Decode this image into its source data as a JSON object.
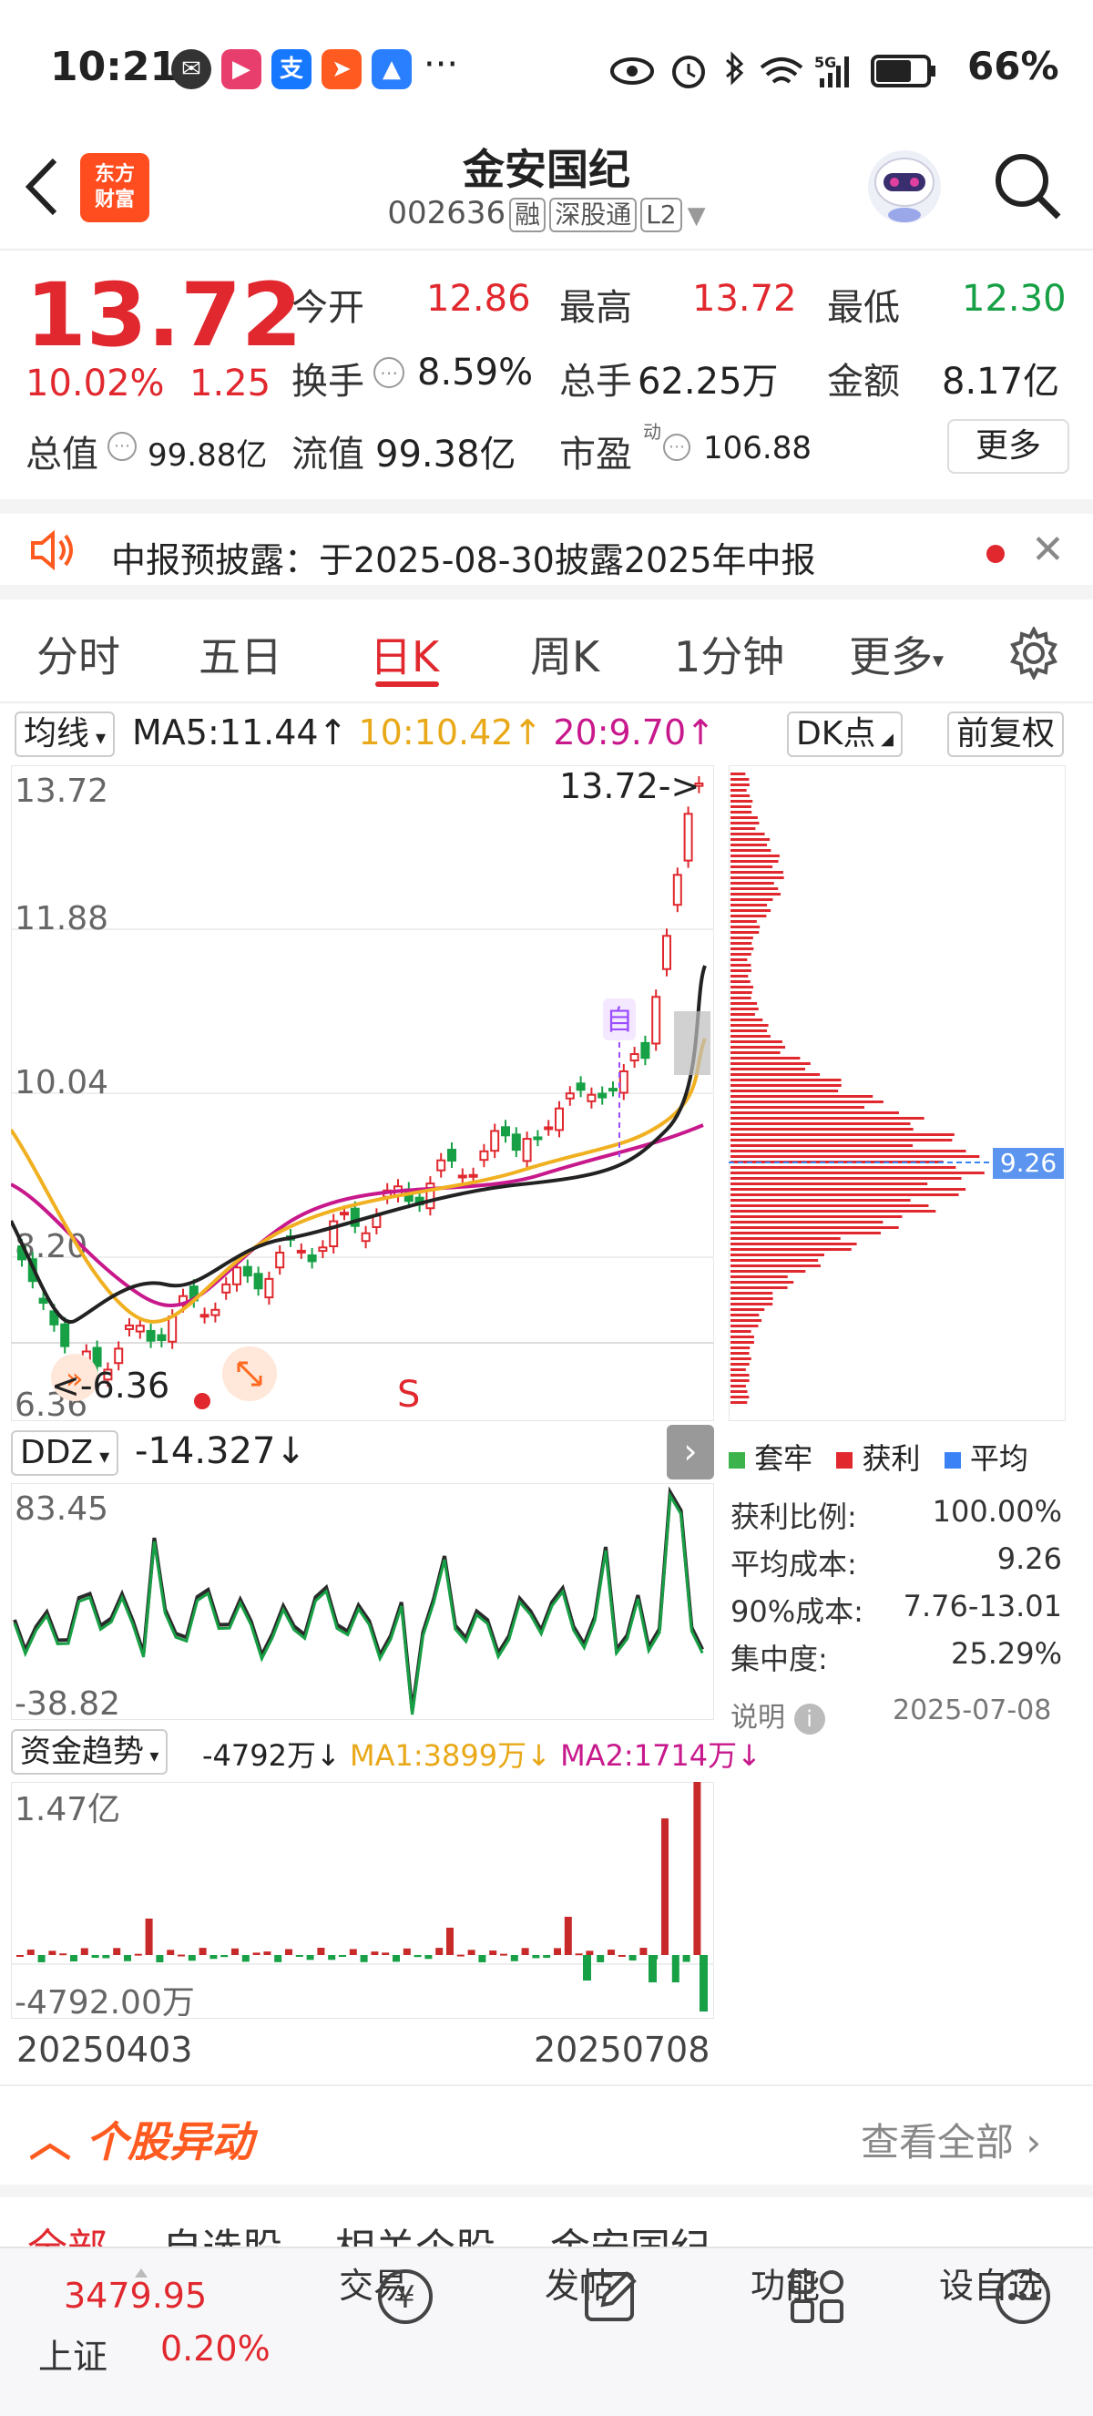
{
  "status_bar": {
    "time": "10:21",
    "battery": "66%",
    "icons": [
      "wechat-icon",
      "video-app-icon",
      "alipay-icon",
      "send-app-icon",
      "nav-app-icon",
      "more-dots",
      "eye-icon",
      "alarm-icon",
      "bluetooth-icon",
      "wifi-icon",
      "5g-signal-icon",
      "battery-icon"
    ]
  },
  "header": {
    "logo_line1": "东方",
    "logo_line2": "财富",
    "stock_name": "金安国纪",
    "stock_code": "002636",
    "tags": [
      "融",
      "深股通",
      "L2"
    ]
  },
  "quote": {
    "price": "13.72",
    "change_pct": "10.02%",
    "change_amt": "1.25",
    "open_label": "今开",
    "open": "12.86",
    "high_label": "最高",
    "high": "13.72",
    "low_label": "最低",
    "low": "12.30",
    "turnover_label": "换手",
    "turnover": "8.59%",
    "volume_label": "总手",
    "volume": "62.25万",
    "amount_label": "金额",
    "amount": "8.17亿",
    "mktcap_label": "总值",
    "mktcap": "99.88亿",
    "float_label": "流值",
    "float_cap": "99.38亿",
    "pe_label": "市盈",
    "pe_sup": "动",
    "pe": "106.88",
    "more_label": "更多"
  },
  "notice": {
    "text": "中报预披露：于2025-08-30披露2025年中报"
  },
  "tabs": [
    "分时",
    "五日",
    "日K",
    "周K",
    "1分钟",
    "更多"
  ],
  "active_tab": "日K",
  "kline_toolbar": {
    "indicator": "均线",
    "ma5": "MA5:11.44↑",
    "ma10": "10:10.42↑",
    "ma20": "20:9.70↑",
    "dk_label": "DK点",
    "adjust_label": "前复权",
    "colors": {
      "ma5": "#222222",
      "ma10": "#f0b020",
      "ma20": "#c8198c"
    }
  },
  "kline": {
    "y_ticks": [
      "13.72",
      "11.88",
      "10.04",
      "8.20",
      "6.36"
    ],
    "high_marker": "13.72->",
    "low_marker": "<-6.36",
    "self_marker": "自",
    "s_marker": "S"
  },
  "chip": {
    "avg_label": "9.26",
    "legend": [
      "套牢",
      "获利",
      "平均"
    ],
    "legend_colors": [
      "#3cb44b",
      "#e0282e",
      "#3b82f6"
    ],
    "stats": [
      {
        "label": "获利比例:",
        "value": "100.00%"
      },
      {
        "label": "平均成本:",
        "value": "9.26"
      },
      {
        "label": "90%成本:",
        "value": "7.76-13.01"
      },
      {
        "label": "集中度:",
        "value": "25.29%"
      }
    ],
    "note_label": "说明",
    "date": "2025-07-08"
  },
  "ddz": {
    "label": "DDZ",
    "value": "-14.327↓",
    "max": "83.45",
    "min": "-38.82"
  },
  "fund": {
    "label": "资金趋势",
    "value": "-4792万↓",
    "ma1": "MA1:3899万↓",
    "ma2": "MA2:1714万↓",
    "max": "1.47亿",
    "min": "-4792.00万",
    "date_start": "20250403",
    "date_end": "20250708"
  },
  "section": {
    "title": "个股异动",
    "see_all": "查看全部",
    "subtabs": [
      "全部",
      "自选股",
      "相关个股",
      "金安国纪"
    ]
  },
  "navbar": {
    "index_value": "3479.95",
    "index_name": "上证",
    "index_change": "0.20%",
    "items": [
      "交易",
      "发帖",
      "功能",
      "设自选"
    ]
  }
}
